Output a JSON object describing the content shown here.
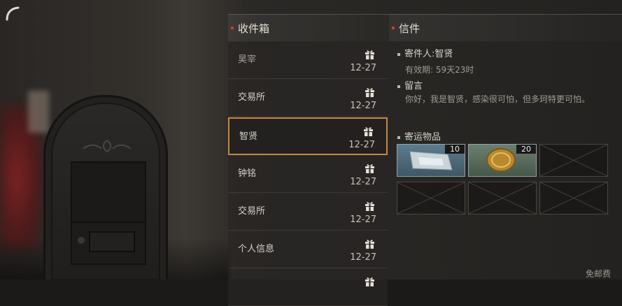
{
  "inbox": {
    "title": "收件箱",
    "mails": [
      {
        "sender": "昊宰",
        "date": "12-27",
        "selected": false
      },
      {
        "sender": "交易所",
        "date": "12-27",
        "selected": false
      },
      {
        "sender": "智贤",
        "date": "12-27",
        "selected": true
      },
      {
        "sender": "钟铭",
        "date": "12-27",
        "selected": false
      },
      {
        "sender": "交易所",
        "date": "12-27",
        "selected": false
      },
      {
        "sender": "个人信息",
        "date": "12-27",
        "selected": false
      },
      {
        "sender": "",
        "date": "",
        "selected": false
      }
    ]
  },
  "letter": {
    "title": "信件",
    "sender_label": "寄件人:智贤",
    "expiry": "有效期: 59天23时",
    "message_label": "留言",
    "message": "你好，我是智贤，感染很可怕，但多珂特更可怕。",
    "items_label": "寄运物品",
    "items": [
      {
        "icon": "bandage-pack-icon",
        "quantity": "10"
      },
      {
        "icon": "gold-coin-icon",
        "quantity": "20"
      }
    ],
    "footer_note": "免邮费"
  },
  "colors": {
    "accent_red": "#c0402e",
    "selection_orange": "#c8873c"
  }
}
